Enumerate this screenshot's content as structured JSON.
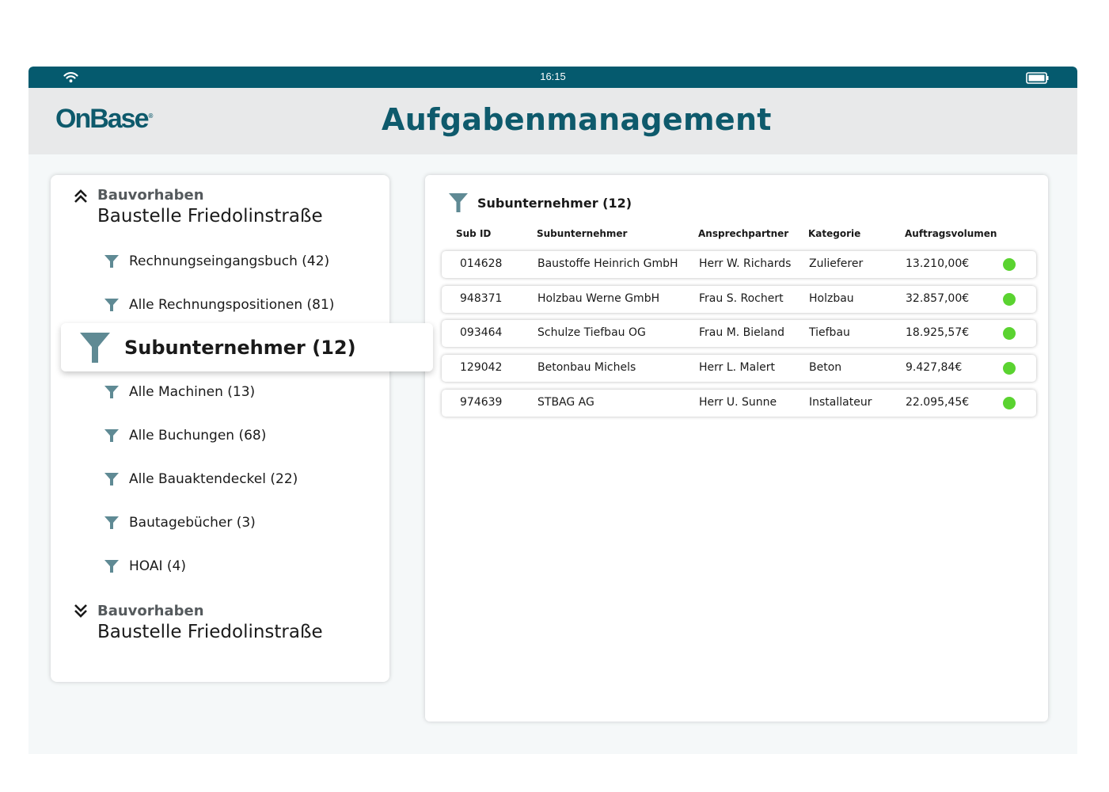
{
  "status_bar": {
    "time": "16:15",
    "wifi_icon": "wifi-icon",
    "battery_icon": "battery-icon"
  },
  "header": {
    "logo": "OnBase",
    "logo_mark": "®",
    "title": "Aufgabenmanagement"
  },
  "colors": {
    "brand": "#055a6e",
    "title": "#0e5a6c",
    "filter_icon": "#5f8a94",
    "status_ok": "#5ad330"
  },
  "sidebar": {
    "groups": [
      {
        "label": "Bauvorhaben",
        "name": "Baustelle Friedolinstraße",
        "expanded": true,
        "icon": "chevron-double-up-icon",
        "items": [
          {
            "label": "Rechnungseingangsbuch (42)"
          },
          {
            "label": "Alle Rechnungspositionen (81)"
          },
          {
            "label": "Subunternehmer (12)",
            "active": true
          },
          {
            "label": "Alle Machinen (13)"
          },
          {
            "label": "Alle Buchungen (68)"
          },
          {
            "label": "Alle Bauaktendeckel (22)"
          },
          {
            "label": "Bautagebücher (3)"
          },
          {
            "label": "HOAI (4)"
          }
        ]
      },
      {
        "label": "Bauvorhaben",
        "name": "Baustelle Friedolinstraße",
        "expanded": false,
        "icon": "chevron-double-down-icon"
      }
    ]
  },
  "main": {
    "title": "Subunternehmer (12)",
    "columns": [
      "Sub ID",
      "Subunternehmer",
      "Ansprechpartner",
      "Kategorie",
      "Auftragsvolumen"
    ],
    "rows": [
      {
        "id": "014628",
        "name": "Baustoffe Heinrich GmbH",
        "contact": "Herr W. Richards",
        "category": "Zulieferer",
        "volume": "13.210,00€",
        "status": "ok"
      },
      {
        "id": "948371",
        "name": "Holzbau Werne GmbH",
        "contact": "Frau S. Rochert",
        "category": "Holzbau",
        "volume": "32.857,00€",
        "status": "ok"
      },
      {
        "id": "093464",
        "name": "Schulze Tiefbau OG",
        "contact": "Frau M. Bieland",
        "category": "Tiefbau",
        "volume": "18.925,57€",
        "status": "ok"
      },
      {
        "id": "129042",
        "name": "Betonbau Michels",
        "contact": "Herr L. Malert",
        "category": "Beton",
        "volume": "9.427,84€",
        "status": "ok"
      },
      {
        "id": "974639",
        "name": "STBAG AG",
        "contact": "Herr U. Sunne",
        "category": "Installateur",
        "volume": "22.095,45€",
        "status": "ok"
      }
    ]
  }
}
